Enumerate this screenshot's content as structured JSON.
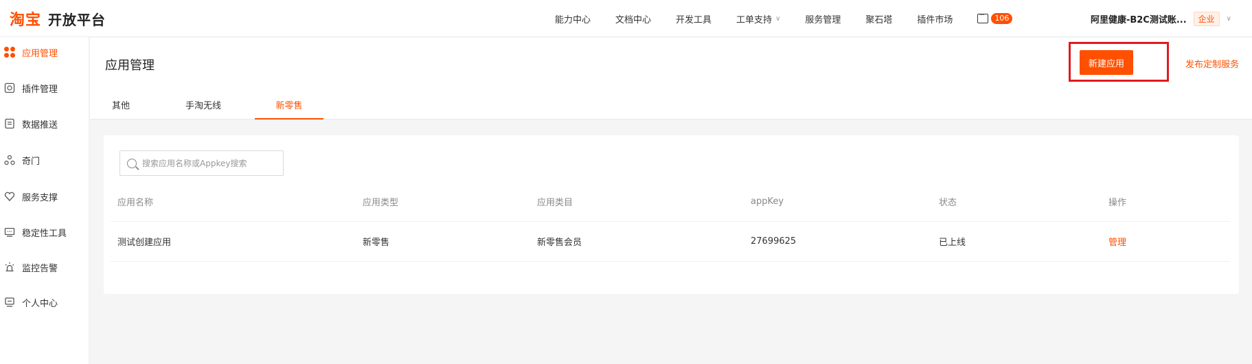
{
  "topbar": {
    "logo_mark": "淘宝",
    "logo_text": "开放平台",
    "nav": [
      {
        "label": "能力中心"
      },
      {
        "label": "文档中心"
      },
      {
        "label": "开发工具"
      },
      {
        "label": "工单支持",
        "has_dropdown": true
      },
      {
        "label": "服务管理"
      },
      {
        "label": "聚石塔"
      },
      {
        "label": "插件市场"
      }
    ],
    "message_count": "106",
    "account_name": "阿里健康-B2C测试账...",
    "account_tag": "企业"
  },
  "sidebar": {
    "items": [
      {
        "label": "应用管理",
        "icon": "app-grid-icon",
        "active": true
      },
      {
        "label": "插件管理",
        "icon": "plugin-icon"
      },
      {
        "label": "数据推送",
        "icon": "document-icon"
      },
      {
        "label": "奇门",
        "icon": "nodes-icon"
      },
      {
        "label": "服务支撑",
        "icon": "heart-icon"
      },
      {
        "label": "稳定性工具",
        "icon": "monitor-icon"
      },
      {
        "label": "监控告警",
        "icon": "alarm-icon"
      },
      {
        "label": "个人中心",
        "icon": "user-card-icon"
      }
    ]
  },
  "header": {
    "title": "应用管理",
    "create_button": "新建应用",
    "publish_link": "发布定制服务",
    "tabs": [
      {
        "label": "其他"
      },
      {
        "label": "手淘无线"
      },
      {
        "label": "新零售",
        "active": true
      }
    ]
  },
  "search": {
    "placeholder": "搜索应用名称或Appkey搜索",
    "value": ""
  },
  "table": {
    "columns": [
      "应用名称",
      "应用类型",
      "应用类目",
      "appKey",
      "状态",
      "操作"
    ],
    "rows": [
      {
        "name": "测试创建应用",
        "type": "新零售",
        "category": "新零售会员",
        "appkey": "27699625",
        "status": "已上线",
        "action": "管理"
      }
    ]
  },
  "colors": {
    "accent": "#ff5000",
    "highlight_frame": "#e0191f"
  }
}
